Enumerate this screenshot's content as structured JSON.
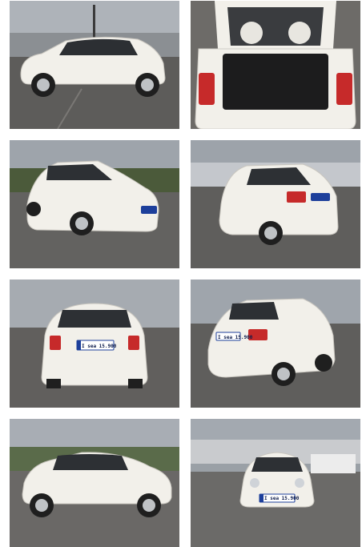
{
  "gallery": {
    "photos": [
      {
        "view": "side-left",
        "plate": ""
      },
      {
        "view": "rear-open-trunk",
        "plate": ""
      },
      {
        "view": "front-three-quarter",
        "plate": ""
      },
      {
        "view": "rear-three-quarter",
        "plate": ""
      },
      {
        "view": "rear",
        "plate": "I sea 15.900"
      },
      {
        "view": "rear-three-quarter-right",
        "plate": "I sea 15.900"
      },
      {
        "view": "side-right",
        "plate": ""
      },
      {
        "view": "front",
        "plate": "I sea 15.900"
      }
    ]
  },
  "colors": {
    "car_body": "#f2f0ea",
    "sky": "#a8adb4",
    "pavement": "#5f5e5c",
    "plate_blue": "#1d3f9b"
  }
}
